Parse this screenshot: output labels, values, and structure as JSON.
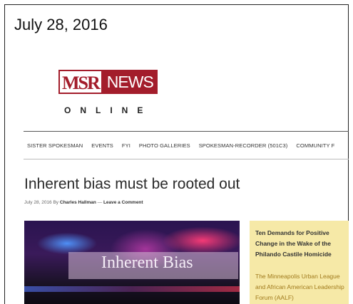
{
  "caption": {
    "date": "July 28, 2016"
  },
  "logo": {
    "msr": "MSR",
    "news": "NEWS",
    "online": "ONLINE"
  },
  "nav": {
    "items": [
      "SISTER SPOKESMAN",
      "EVENTS",
      "FYI",
      "PHOTO GALLERIES",
      "SPOKESMAN-RECORDER (501C3)",
      "COMMUNITY F"
    ]
  },
  "article": {
    "title": "Inherent bias must be rooted out",
    "byline_prefix": "July 28, 2016 By",
    "author": "Charles Hallman",
    "separator": "—",
    "comment_link": "Leave a Comment",
    "hero_caption": "Inherent Bias"
  },
  "sidebar": {
    "heading": "Ten Demands for Positive Change in the Wake of the Philando Castile Homicide",
    "body": "The Minneapolis Urban League and African American Leadership Forum (AALF)"
  },
  "colors": {
    "brand": "#a31d2b",
    "sidebar_bg": "#f6e9a7",
    "sidebar_text": "#a07a1c"
  }
}
